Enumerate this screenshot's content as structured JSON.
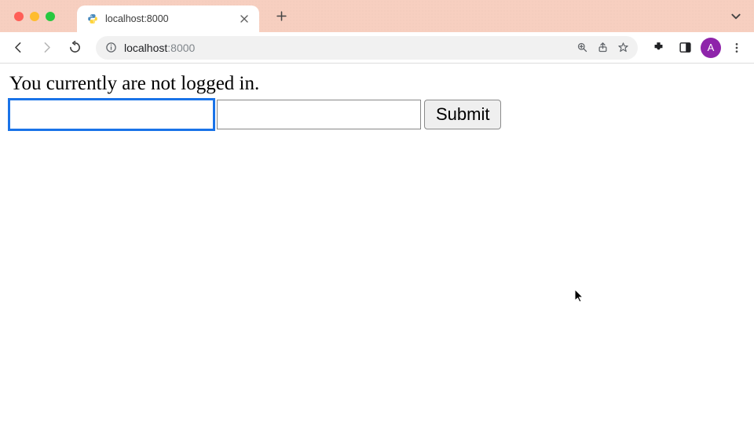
{
  "browser": {
    "tab_title": "localhost:8000",
    "url_host": "localhost",
    "url_port": ":8000",
    "avatar_letter": "A"
  },
  "page": {
    "status_text": "You currently are not logged in.",
    "input1_value": "",
    "input2_value": "",
    "submit_label": "Submit"
  }
}
